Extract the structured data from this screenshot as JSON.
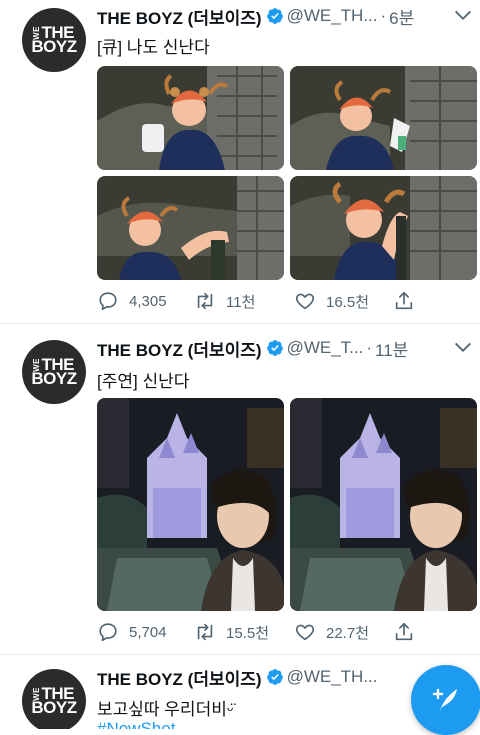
{
  "tweets": [
    {
      "account_name": "THE BOYZ (더보이즈)",
      "handle": "@WE_TH...",
      "time": "6분",
      "text": "[큐] 나도 신난다",
      "replies": "4,305",
      "retweets": "11천",
      "likes": "16.5천"
    },
    {
      "account_name": "THE BOYZ (더보이즈)",
      "handle": "@WE_T...",
      "time": "11분",
      "text": "[주연] 신난다",
      "replies": "5,704",
      "retweets": "15.5천",
      "likes": "22.7천"
    },
    {
      "account_name": "THE BOYZ (더보이즈)",
      "handle": "@WE_TH...",
      "time": "",
      "text": "보고싶따 우리더비ᵕ̈",
      "hashtag": "#NowShot"
    }
  ],
  "avatar_logo": {
    "we": "WE",
    "the": "THE",
    "boyz": "BOYZ"
  },
  "colors": {
    "accent": "#1d9bf0",
    "muted": "#536471",
    "separator": "#e6ecf0"
  },
  "icons": {
    "verified": "verified-badge-icon",
    "caret": "chevron-down-icon",
    "reply": "reply-icon",
    "retweet": "retweet-icon",
    "like": "heart-icon",
    "share": "share-icon",
    "compose": "compose-tweet-icon"
  }
}
